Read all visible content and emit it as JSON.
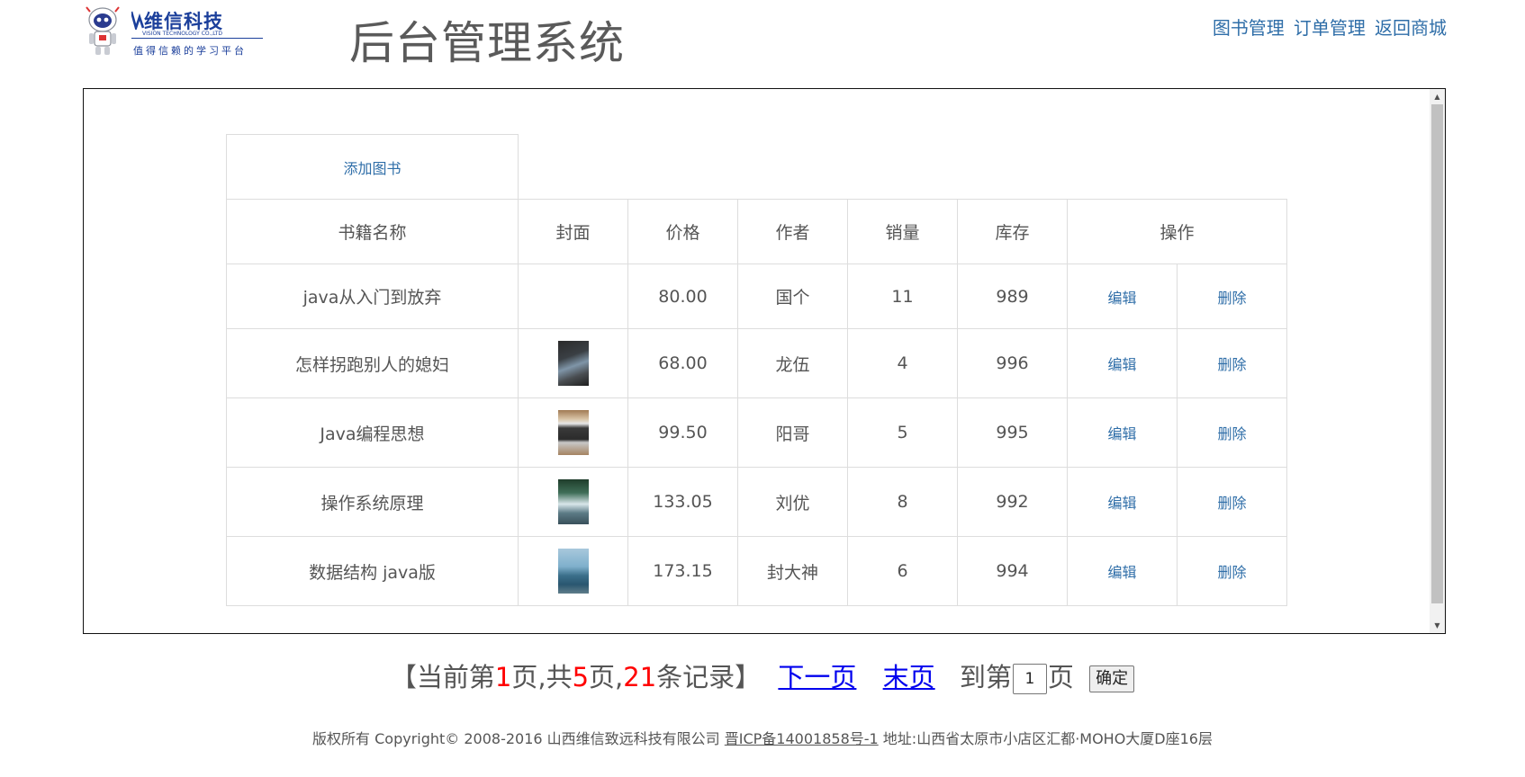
{
  "header": {
    "logo": {
      "brand_name": "维信科技",
      "brand_en": "VISION TECHNOLOGY CO.,LTD",
      "slogan": "值得信赖的学习平台"
    },
    "title": "后台管理系统",
    "nav": [
      {
        "label": "图书管理"
      },
      {
        "label": "订单管理"
      },
      {
        "label": "返回商城"
      }
    ]
  },
  "table": {
    "add_label": "添加图书",
    "headers": [
      "书籍名称",
      "封面",
      "价格",
      "作者",
      "销量",
      "库存",
      "操作"
    ],
    "edit_label": "编辑",
    "delete_label": "删除",
    "rows": [
      {
        "name": "java从入门到放弃",
        "cover": "",
        "price": "80.00",
        "author": "国个",
        "sales": "11",
        "stock": "989"
      },
      {
        "name": "怎样拐跑别人的媳妇",
        "cover": "laptop-hand-image",
        "price": "68.00",
        "author": "龙伍",
        "sales": "4",
        "stock": "996"
      },
      {
        "name": "Java编程思想",
        "cover": "laptop-image",
        "price": "99.50",
        "author": "阳哥",
        "sales": "5",
        "stock": "995"
      },
      {
        "name": "操作系统原理",
        "cover": "waterfall-image",
        "price": "133.05",
        "author": "刘优",
        "sales": "8",
        "stock": "992"
      },
      {
        "name": "数据结构 java版",
        "cover": "sea-image",
        "price": "173.15",
        "author": "封大神",
        "sales": "6",
        "stock": "994"
      }
    ]
  },
  "pagination": {
    "prefix": "【当前第",
    "current_page": "1",
    "text_mid1": "页,共",
    "total_pages": "5",
    "text_mid2": "页,",
    "total_records": "21",
    "suffix": "条记录】",
    "next_label": "下一页",
    "last_label": "末页",
    "goto_prefix": "到第",
    "goto_value": "1",
    "goto_suffix": "页",
    "confirm_label": "确定"
  },
  "footer": {
    "copyright": "版权所有 Copyright© 2008-2016 山西维信致远科技有限公司",
    "icp": "晋ICP备14001858号-1",
    "address": "地址:山西省太原市小店区汇都·MOHO大厦D座16层"
  },
  "colors": {
    "link": "#2f6ea8",
    "brand": "#1b3f9b",
    "highlight": "#ff0000",
    "pager_link": "#0000ee"
  }
}
